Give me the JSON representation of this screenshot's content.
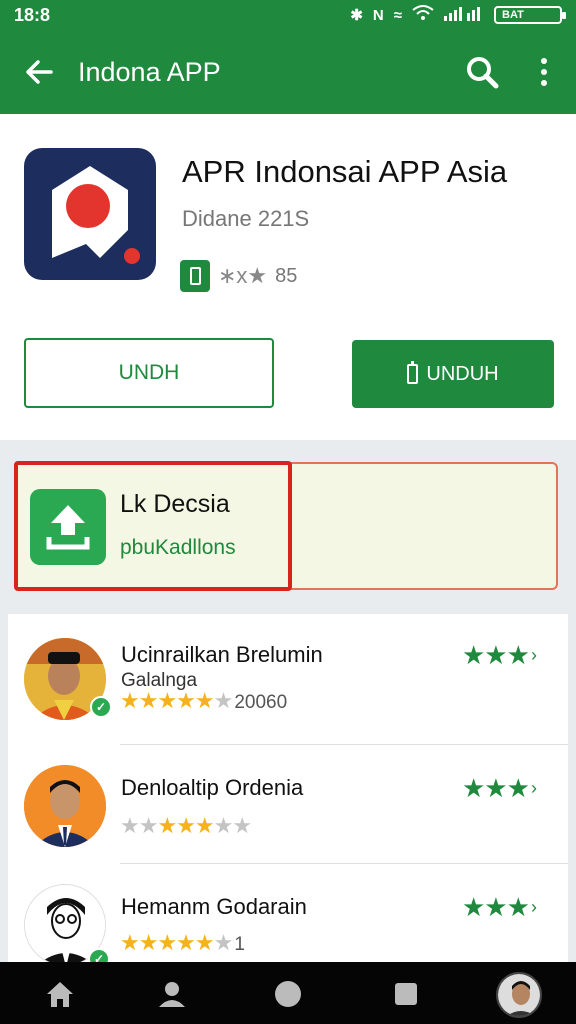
{
  "status_bar": {
    "time": "18:8",
    "battery_label": "BAT"
  },
  "app_bar": {
    "title": "Indona APP"
  },
  "app": {
    "name": "APR Indonsai APP Asia",
    "developer": "Didane 221S",
    "rating_text": "∗x★",
    "rating_count": "85"
  },
  "buttons": {
    "secondary_label": "UNDH",
    "primary_label": "UNDUH"
  },
  "promo": {
    "title": "Lk Decsia",
    "subtitle": "pbuKadllons"
  },
  "reviews": [
    {
      "name": "Ucinrailkan Brelumin",
      "sub": "Galalnga",
      "stars_on": "★★★★★",
      "stars_off": "★",
      "count": "20060",
      "green_stars": "★★★"
    },
    {
      "name": "Denloaltip Ordenia",
      "sub": "",
      "stars_on": "★★★",
      "stars_off": "★★",
      "count": "",
      "green_stars": "★★★"
    },
    {
      "name": "Hemanm Godarain",
      "sub": "",
      "stars_on": "★★★★★",
      "stars_off": "★",
      "count": "1",
      "green_stars": "★★★"
    }
  ],
  "colors": {
    "brand_green": "#1f8a3e",
    "highlight_red": "#d9231f",
    "star_gold": "#f5b21a"
  },
  "icons": [
    "arrow-back-icon",
    "search-icon",
    "more-vert-icon",
    "download-icon",
    "home-icon",
    "person-icon",
    "circle-icon",
    "square-icon"
  ]
}
